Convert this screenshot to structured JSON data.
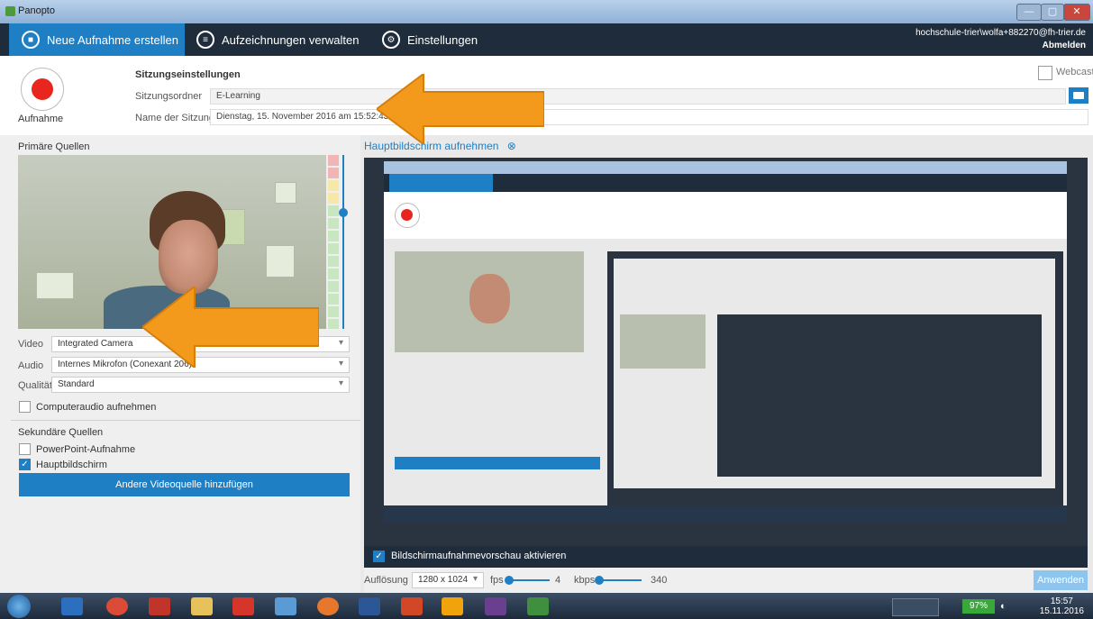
{
  "window": {
    "title": "Panopto",
    "controls": [
      "—",
      "▢",
      "✕"
    ]
  },
  "nav": {
    "tabs": [
      {
        "label": "Neue Aufnahme erstellen",
        "icon": "camera-icon"
      },
      {
        "label": "Aufzeichnungen verwalten",
        "icon": "list-icon"
      },
      {
        "label": "Einstellungen",
        "icon": "gear-icon"
      }
    ],
    "user": "hochschule-trier\\wolfa+882270@fh-trier.de",
    "logout": "Abmelden"
  },
  "session": {
    "record_label": "Aufnahme",
    "heading": "Sitzungseinstellungen",
    "folder_label": "Sitzungsordner",
    "folder_value": "E-Learning",
    "name_label": "Name der Sitzung",
    "name_value": "Dienstag, 15. November 2016 am 15:52:43",
    "webcast_label": "Webcast"
  },
  "primary": {
    "title": "Primäre Quellen",
    "video_label": "Video",
    "video_value": "Integrated Camera",
    "audio_label": "Audio",
    "audio_value": "Internes Mikrofon (Conexant 206)",
    "quality_label": "Qualität",
    "quality_value": "Standard",
    "computer_audio": "Computeraudio aufnehmen"
  },
  "secondary": {
    "title": "Sekundäre Quellen",
    "powerpoint": "PowerPoint-Aufnahme",
    "mainscreen": "Hauptbildschirm",
    "add_button": "Andere Videoquelle hinzufügen"
  },
  "preview": {
    "tab": "Hauptbildschirm aufnehmen",
    "enable_label": "Bildschirmaufnahmevorschau aktivieren",
    "resolution_label": "Auflösung",
    "resolution_value": "1280 x 1024",
    "fps_label": "fps",
    "fps_value": "4",
    "kbps_label": "kbps",
    "kbps_value": "340",
    "apply": "Anwenden"
  },
  "taskbar": {
    "battery": "97%",
    "time": "15:57",
    "date": "15.11.2016"
  }
}
